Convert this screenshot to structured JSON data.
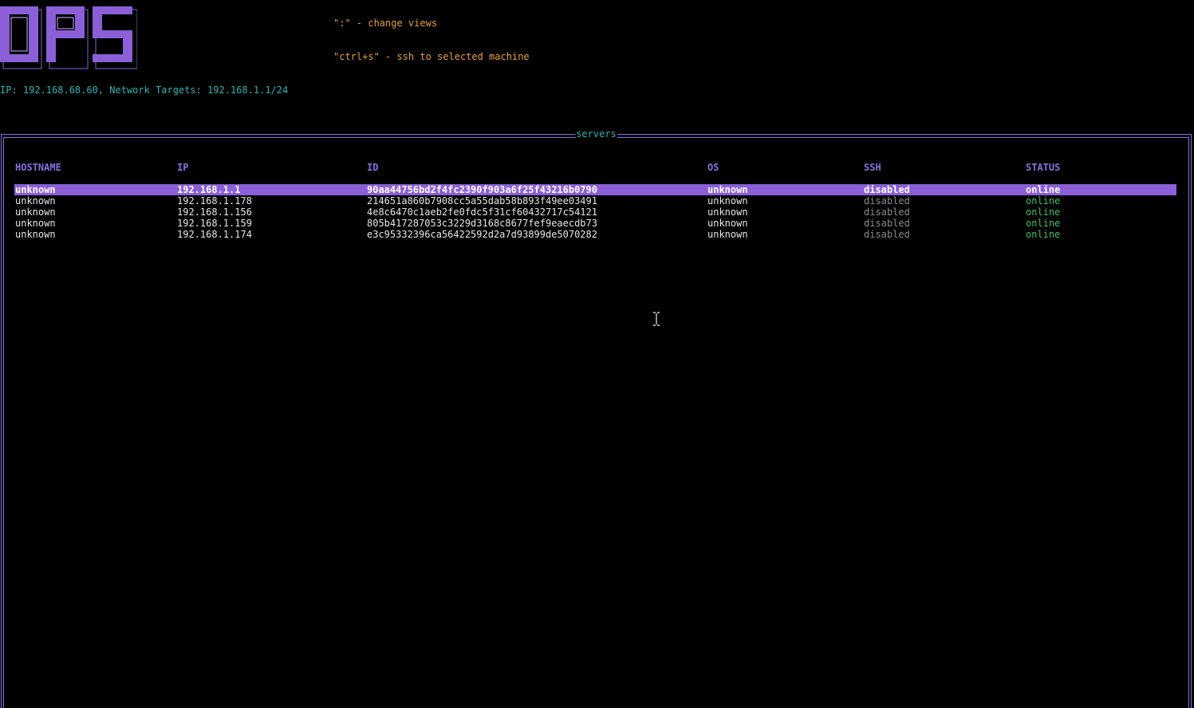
{
  "logo": {
    "text": "OPS",
    "icon": "ops-ascii-logo"
  },
  "hints": {
    "change_views": "\":\" - change views",
    "ssh": "\"ctrl+s\" - ssh to selected machine"
  },
  "network_info": "IP: 192.168.68.60, Network Targets: 192.168.1.1/24",
  "panel": {
    "title": "servers"
  },
  "table": {
    "headers": {
      "hostname": "HOSTNAME",
      "ip": "IP",
      "id": "ID",
      "os": "OS",
      "ssh": "SSH",
      "status": "STATUS"
    },
    "rows": [
      {
        "hostname": "unknown",
        "ip": "192.168.1.1",
        "id": "90aa44756bd2f4fc2390f903a6f25f43216b0790",
        "os": "unknown",
        "ssh": "disabled",
        "status": "online",
        "selected": true
      },
      {
        "hostname": "unknown",
        "ip": "192.168.1.178",
        "id": "214651a860b7908cc5a55dab58b893f49ee03491",
        "os": "unknown",
        "ssh": "disabled",
        "status": "online",
        "selected": false
      },
      {
        "hostname": "unknown",
        "ip": "192.168.1.156",
        "id": "4e8c6470c1aeb2fe0fdc5f31cf60432717c54121",
        "os": "unknown",
        "ssh": "disabled",
        "status": "online",
        "selected": false
      },
      {
        "hostname": "unknown",
        "ip": "192.168.1.159",
        "id": "805b417287053c3229d3168c8677fef9eaecdb73",
        "os": "unknown",
        "ssh": "disabled",
        "status": "online",
        "selected": false
      },
      {
        "hostname": "unknown",
        "ip": "192.168.1.174",
        "id": "e3c95332396ca56422592d2a7d93899de5070282",
        "os": "unknown",
        "ssh": "disabled",
        "status": "online",
        "selected": false
      }
    ]
  },
  "colors": {
    "accent": "#8a6fe0",
    "selection": "#8a5fd8",
    "hint": "#e5a03c",
    "info": "#2fb3b3",
    "online": "#3fbf5f",
    "disabled": "#8a8a8a"
  },
  "cursor": {
    "icon": "text-cursor-icon"
  }
}
